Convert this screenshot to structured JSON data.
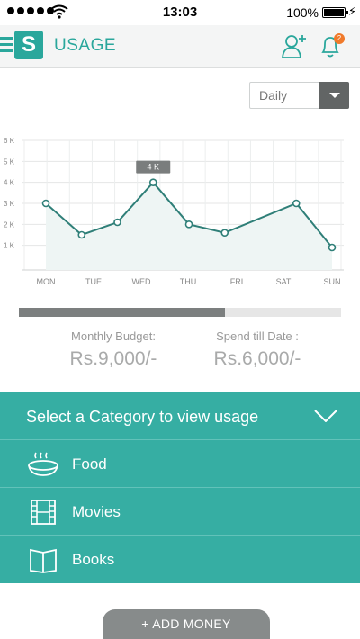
{
  "status_bar": {
    "time": "13:03",
    "battery": "100%"
  },
  "app_bar": {
    "logo_letter": "S",
    "title": "USAGE",
    "notification_count": "2"
  },
  "range_select": {
    "value": "Daily"
  },
  "chart_data": {
    "type": "line",
    "categories": [
      "MON",
      "TUE",
      "WED",
      "THU",
      "FRI",
      "SAT",
      "SUN"
    ],
    "x": [
      "MON",
      "",
      "TUE",
      "WED",
      "THU",
      "FRI",
      "",
      "SAT",
      "SUN"
    ],
    "values": [
      3.0,
      1.5,
      2.1,
      4.0,
      2.0,
      1.6,
      3.0,
      0.9
    ],
    "highlight": {
      "index": 3,
      "label": "4 K"
    },
    "yticks": [
      "1 K",
      "2 K",
      "3 K",
      "4 K",
      "5 K",
      "6 K"
    ],
    "ylim": [
      0,
      6
    ],
    "grid": true,
    "color": "#2f7f78",
    "fill": "#eef5f4"
  },
  "budget": {
    "progress_fraction": 0.64,
    "monthly_label": "Monthly Budget:",
    "monthly_value": "Rs.9,000/-",
    "spend_label": "Spend till Date :",
    "spend_value": "Rs.6,000/-"
  },
  "category": {
    "header": "Select a Category to view usage",
    "items": [
      {
        "label": "Food",
        "icon": "food-bowl-icon"
      },
      {
        "label": "Movies",
        "icon": "film-strip-icon"
      },
      {
        "label": "Books",
        "icon": "open-book-icon"
      }
    ]
  },
  "add_money_label": "+ ADD MONEY",
  "colors": {
    "accent": "#36aea3",
    "dark": "#626565"
  }
}
